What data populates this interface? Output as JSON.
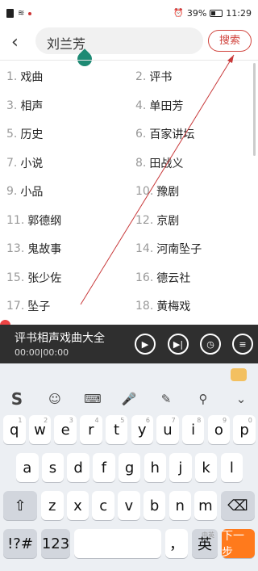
{
  "status_bar": {
    "battery": "39%",
    "time": "11:29"
  },
  "header": {
    "query": "刘兰芳",
    "search_label": "搜索"
  },
  "list": [
    {
      "num": "1.",
      "text": "戏曲"
    },
    {
      "num": "2.",
      "text": "评书"
    },
    {
      "num": "3.",
      "text": "相声"
    },
    {
      "num": "4.",
      "text": "单田芳"
    },
    {
      "num": "5.",
      "text": "历史"
    },
    {
      "num": "6.",
      "text": "百家讲坛"
    },
    {
      "num": "7.",
      "text": "小说"
    },
    {
      "num": "8.",
      "text": "田战义"
    },
    {
      "num": "9.",
      "text": "小品"
    },
    {
      "num": "10.",
      "text": "豫剧"
    },
    {
      "num": "11.",
      "text": "郭德纲"
    },
    {
      "num": "12.",
      "text": "京剧"
    },
    {
      "num": "13.",
      "text": "鬼故事"
    },
    {
      "num": "14.",
      "text": "河南坠子"
    },
    {
      "num": "15.",
      "text": "张少佐"
    },
    {
      "num": "16.",
      "text": "德云社"
    },
    {
      "num": "17.",
      "text": "坠子"
    },
    {
      "num": "18.",
      "text": "黄梅戏"
    }
  ],
  "player": {
    "title": "评书相声戏曲大全",
    "time": "00:00|00:00"
  },
  "keyboard": {
    "row1": [
      {
        "k": "q",
        "h": "1"
      },
      {
        "k": "w",
        "h": "2"
      },
      {
        "k": "e",
        "h": "3"
      },
      {
        "k": "r",
        "h": "4"
      },
      {
        "k": "t",
        "h": "5"
      },
      {
        "k": "y",
        "h": "6"
      },
      {
        "k": "u",
        "h": "7"
      },
      {
        "k": "i",
        "h": "8"
      },
      {
        "k": "o",
        "h": "9"
      },
      {
        "k": "p",
        "h": "0"
      }
    ],
    "row2": [
      "a",
      "s",
      "d",
      "f",
      "g",
      "h",
      "j",
      "k",
      "l"
    ],
    "row3": [
      "z",
      "x",
      "c",
      "v",
      "b",
      "n",
      "m"
    ],
    "shift_icon": "⇧",
    "backspace_icon": "⌫",
    "sym_label": "!?#",
    "num_label": "123",
    "comma_label": "，",
    "cn_en_label": "中英",
    "en_label": "英",
    "next_label": "下一步",
    "tools": [
      "sogou-logo",
      "emoji-icon",
      "keyboard-icon",
      "mic-icon",
      "pen-icon",
      "search-icon",
      "collapse-icon"
    ]
  },
  "colors": {
    "accent": "#d0423b",
    "player_bg": "#2f2f2f",
    "next_key": "#ff7a1c",
    "annotation": "#c8393a"
  }
}
